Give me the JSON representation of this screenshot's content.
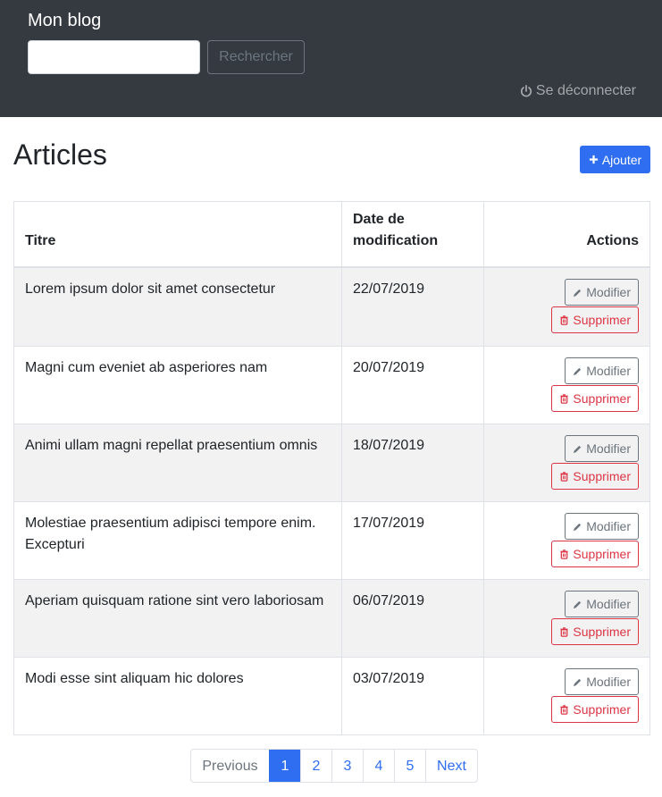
{
  "header": {
    "brand": "Mon blog",
    "search_placeholder": "",
    "search_button": "Rechercher",
    "logout_label": "Se déconnecter"
  },
  "main": {
    "title": "Articles",
    "add_button": "Ajouter"
  },
  "table": {
    "headers": {
      "title": "Titre",
      "date": "Date de modification",
      "actions": "Actions"
    },
    "rows": [
      {
        "title": "Lorem ipsum dolor sit amet consectetur",
        "date": "22/07/2019",
        "edit": "Modifier",
        "delete": "Supprimer"
      },
      {
        "title": "Magni cum eveniet ab asperiores nam",
        "date": "20/07/2019",
        "edit": "Modifier",
        "delete": "Supprimer"
      },
      {
        "title": "Animi ullam magni repellat praesentium omnis",
        "date": "18/07/2019",
        "edit": "Modifier",
        "delete": "Supprimer"
      },
      {
        "title": "Molestiae praesentium adipisci tempore enim. Excepturi",
        "date": "17/07/2019",
        "edit": "Modifier",
        "delete": "Supprimer"
      },
      {
        "title": "Aperiam quisquam ratione sint vero laboriosam",
        "date": "06/07/2019",
        "edit": "Modifier",
        "delete": "Supprimer"
      },
      {
        "title": "Modi esse sint aliquam hic dolores",
        "date": "03/07/2019",
        "edit": "Modifier",
        "delete": "Supprimer"
      }
    ]
  },
  "pagination": {
    "previous": "Previous",
    "pages": [
      "1",
      "2",
      "3",
      "4",
      "5"
    ],
    "active_page": "1",
    "next": "Next"
  },
  "icons": {
    "logout": "power-icon",
    "add": "plus-icon",
    "edit": "pencil-icon",
    "delete": "trash-icon"
  },
  "colors": {
    "navbar": "#343a40",
    "primary": "#2f6ef0",
    "danger": "#dc3545",
    "secondary": "#6c757d",
    "stripe": "#f2f2f2"
  }
}
